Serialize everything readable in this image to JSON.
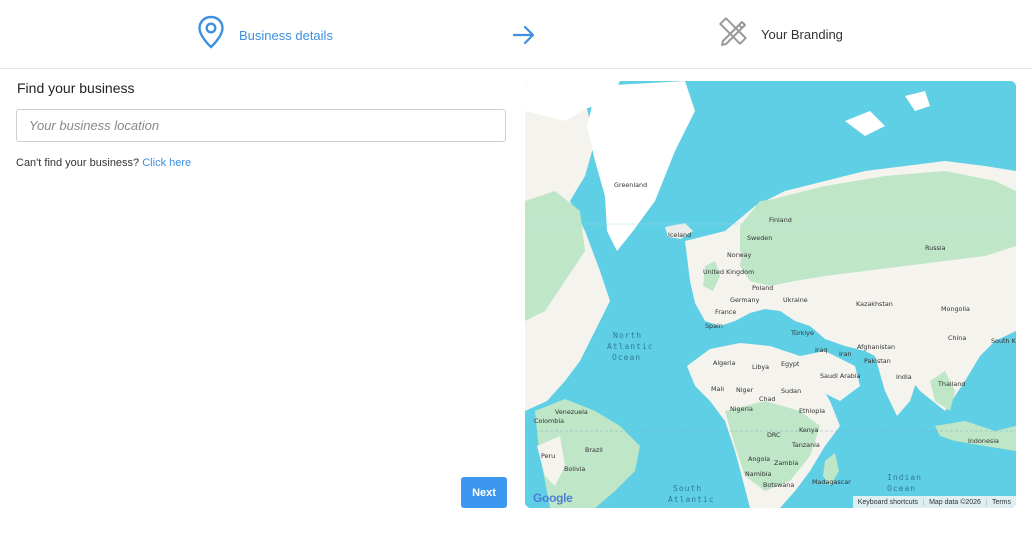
{
  "stepper": {
    "step1_label": "Business details",
    "step1_icon": "map-pin-icon",
    "arrow_icon": "arrow-right-icon",
    "step2_label": "Your Branding",
    "step2_icon": "pencil-ruler-icon",
    "active_color": "#3d8fe0",
    "inactive_color": "#999999"
  },
  "form": {
    "title": "Find your business",
    "search_placeholder": "Your business location",
    "cant_find_text": "Can't find your business?",
    "click_here": "Click here",
    "next_label": "Next"
  },
  "map": {
    "countries": [
      "Greenland",
      "Iceland",
      "Finland",
      "Sweden",
      "Norway",
      "Russia",
      "United Kingdom",
      "Poland",
      "Germany",
      "Ukraine",
      "Kazakhstan",
      "France",
      "Mongolia",
      "Spain",
      "Türkiye",
      "China",
      "Afghanistan",
      "Iran",
      "Iraq",
      "Pakistan",
      "Algeria",
      "Libya",
      "Egypt",
      "Saudi Arabia",
      "India",
      "Thailand",
      "Mali",
      "Niger",
      "Chad",
      "Sudan",
      "Nigeria",
      "Ethiopia",
      "Venezuela",
      "Colombia",
      "Kenya",
      "DRC",
      "Tanzania",
      "Brazil",
      "Peru",
      "Angola",
      "Bolivia",
      "Zambia",
      "Namibia",
      "Botswana",
      "Madagascar",
      "Indonesia",
      "South K"
    ],
    "oceans": {
      "north_atlantic": [
        "North",
        "Atlantic",
        "Ocean"
      ],
      "south_atlantic": [
        "South",
        "Atlantic"
      ],
      "indian": [
        "Indian",
        "Ocean"
      ]
    },
    "attribution": {
      "logo": "Google",
      "keyboard": "Keyboard shortcuts",
      "map_data": "Map data ©2026",
      "terms": "Terms"
    },
    "colors": {
      "water": "#5fcfe5",
      "land": "#f4f3ee",
      "green": "#bfe6c7",
      "ice": "#ffffff"
    }
  }
}
